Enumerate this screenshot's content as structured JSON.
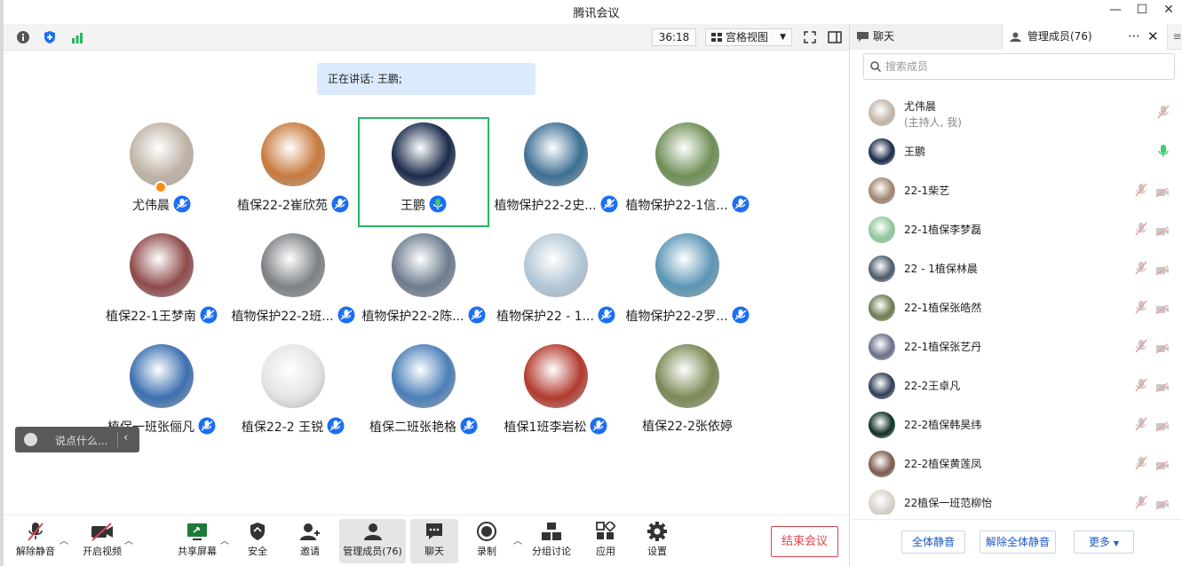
{
  "window": {
    "title": "腾讯会议"
  },
  "toolbar": {
    "timer": "36:18",
    "view_label": "宫格视图"
  },
  "main": {
    "speaking_label": "正在讲话: 王鹏;",
    "participants": [
      {
        "name": "尤伟晨",
        "avatar_color": "#bfb3a5"
      },
      {
        "name": "植保22-2崔欣苑",
        "avatar_color": "#c87a3e"
      },
      {
        "name": "王鹏",
        "avatar_color": "#1b2a4a"
      },
      {
        "name": "植物保护22-2史...",
        "avatar_color": "#3d6f93"
      },
      {
        "name": "植物保护22-1信...",
        "avatar_color": "#6f8f56"
      },
      {
        "name": "植保22-1王梦南",
        "avatar_color": "#8f4a4a"
      },
      {
        "name": "植物保护22-2班...",
        "avatar_color": "#7d8185"
      },
      {
        "name": "植物保护22-2陈...",
        "avatar_color": "#6d7c8e"
      },
      {
        "name": "植物保护22 - 1...",
        "avatar_color": "#b3c7d6"
      },
      {
        "name": "植物保护22-2罗...",
        "avatar_color": "#5b95b5"
      },
      {
        "name": "植保一班张俪凡",
        "avatar_color": "#3b6fb0"
      },
      {
        "name": "植保22-2 王锐",
        "avatar_color": "#e4e4e4"
      },
      {
        "name": "植保二班张艳格",
        "avatar_color": "#4a7fb8"
      },
      {
        "name": "植保1班李岩松",
        "avatar_color": "#b23a2e"
      },
      {
        "name": "植保22-2张依婷",
        "avatar_color": "#7a8a55"
      }
    ],
    "chat_placeholder": "说点什么..."
  },
  "bottom": {
    "unmute": "解除静音",
    "video": "开启视频",
    "share": "共享屏幕",
    "security": "安全",
    "invite": "邀请",
    "members": "管理成员(76)",
    "chat": "聊天",
    "record": "录制",
    "breakout": "分组讨论",
    "apps": "应用",
    "settings": "设置",
    "end": "结束会议"
  },
  "side": {
    "tab_chat": "聊天",
    "tab_members": "管理成员(76)",
    "search_placeholder": "搜索成员",
    "members": [
      {
        "name": "尤伟晨",
        "sub": "(主持人, 我)",
        "avatar_color": "#c2b7a8"
      },
      {
        "name": "王鹏",
        "sub": "",
        "avatar_color": "#1b2a4a"
      },
      {
        "name": "22-1柴艺",
        "sub": "",
        "avatar_color": "#a08470"
      },
      {
        "name": "22-1植保李梦磊",
        "sub": "",
        "avatar_color": "#8fc79a"
      },
      {
        "name": "22 - 1植保林晨",
        "sub": "",
        "avatar_color": "#4a5a6a"
      },
      {
        "name": "22-1植保张皓然",
        "sub": "",
        "avatar_color": "#6b7b4f"
      },
      {
        "name": "22-1植保张艺丹",
        "sub": "",
        "avatar_color": "#6a6f88"
      },
      {
        "name": "22-2王卓凡",
        "sub": "",
        "avatar_color": "#2f3d55"
      },
      {
        "name": "22-2植保韩昊纬",
        "sub": "",
        "avatar_color": "#0d2e22"
      },
      {
        "name": "22-2植保黄莲凤",
        "sub": "",
        "avatar_color": "#7a5b4b"
      },
      {
        "name": "22植保一班范柳怡",
        "sub": "",
        "avatar_color": "#d8d2c8"
      }
    ],
    "mute_all": "全体静音",
    "unmute_all": "解除全体静音",
    "more": "更多"
  },
  "colors": {
    "accent_blue": "#1c6ef2",
    "active_green": "#2ab463",
    "end_red": "#e0434f"
  }
}
